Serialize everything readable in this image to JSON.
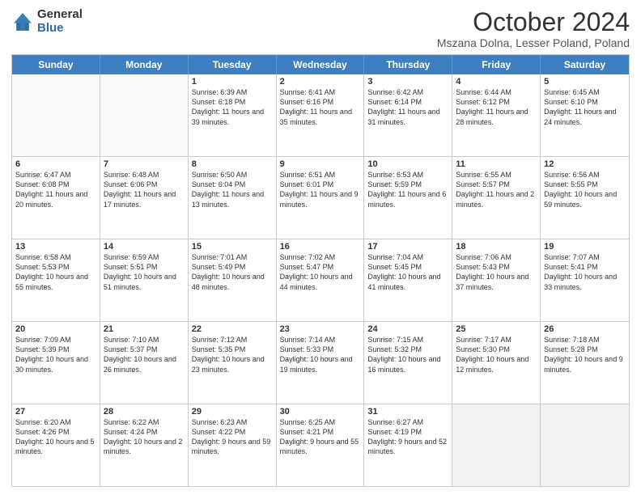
{
  "logo": {
    "general": "General",
    "blue": "Blue"
  },
  "header": {
    "month": "October 2024",
    "location": "Mszana Dolna, Lesser Poland, Poland"
  },
  "days": [
    "Sunday",
    "Monday",
    "Tuesday",
    "Wednesday",
    "Thursday",
    "Friday",
    "Saturday"
  ],
  "weeks": [
    [
      {
        "day": "",
        "content": ""
      },
      {
        "day": "",
        "content": ""
      },
      {
        "day": "1",
        "content": "Sunrise: 6:39 AM\nSunset: 6:18 PM\nDaylight: 11 hours and 39 minutes."
      },
      {
        "day": "2",
        "content": "Sunrise: 6:41 AM\nSunset: 6:16 PM\nDaylight: 11 hours and 35 minutes."
      },
      {
        "day": "3",
        "content": "Sunrise: 6:42 AM\nSunset: 6:14 PM\nDaylight: 11 hours and 31 minutes."
      },
      {
        "day": "4",
        "content": "Sunrise: 6:44 AM\nSunset: 6:12 PM\nDaylight: 11 hours and 28 minutes."
      },
      {
        "day": "5",
        "content": "Sunrise: 6:45 AM\nSunset: 6:10 PM\nDaylight: 11 hours and 24 minutes."
      }
    ],
    [
      {
        "day": "6",
        "content": "Sunrise: 6:47 AM\nSunset: 6:08 PM\nDaylight: 11 hours and 20 minutes."
      },
      {
        "day": "7",
        "content": "Sunrise: 6:48 AM\nSunset: 6:06 PM\nDaylight: 11 hours and 17 minutes."
      },
      {
        "day": "8",
        "content": "Sunrise: 6:50 AM\nSunset: 6:04 PM\nDaylight: 11 hours and 13 minutes."
      },
      {
        "day": "9",
        "content": "Sunrise: 6:51 AM\nSunset: 6:01 PM\nDaylight: 11 hours and 9 minutes."
      },
      {
        "day": "10",
        "content": "Sunrise: 6:53 AM\nSunset: 5:59 PM\nDaylight: 11 hours and 6 minutes."
      },
      {
        "day": "11",
        "content": "Sunrise: 6:55 AM\nSunset: 5:57 PM\nDaylight: 11 hours and 2 minutes."
      },
      {
        "day": "12",
        "content": "Sunrise: 6:56 AM\nSunset: 5:55 PM\nDaylight: 10 hours and 59 minutes."
      }
    ],
    [
      {
        "day": "13",
        "content": "Sunrise: 6:58 AM\nSunset: 5:53 PM\nDaylight: 10 hours and 55 minutes."
      },
      {
        "day": "14",
        "content": "Sunrise: 6:59 AM\nSunset: 5:51 PM\nDaylight: 10 hours and 51 minutes."
      },
      {
        "day": "15",
        "content": "Sunrise: 7:01 AM\nSunset: 5:49 PM\nDaylight: 10 hours and 48 minutes."
      },
      {
        "day": "16",
        "content": "Sunrise: 7:02 AM\nSunset: 5:47 PM\nDaylight: 10 hours and 44 minutes."
      },
      {
        "day": "17",
        "content": "Sunrise: 7:04 AM\nSunset: 5:45 PM\nDaylight: 10 hours and 41 minutes."
      },
      {
        "day": "18",
        "content": "Sunrise: 7:06 AM\nSunset: 5:43 PM\nDaylight: 10 hours and 37 minutes."
      },
      {
        "day": "19",
        "content": "Sunrise: 7:07 AM\nSunset: 5:41 PM\nDaylight: 10 hours and 33 minutes."
      }
    ],
    [
      {
        "day": "20",
        "content": "Sunrise: 7:09 AM\nSunset: 5:39 PM\nDaylight: 10 hours and 30 minutes."
      },
      {
        "day": "21",
        "content": "Sunrise: 7:10 AM\nSunset: 5:37 PM\nDaylight: 10 hours and 26 minutes."
      },
      {
        "day": "22",
        "content": "Sunrise: 7:12 AM\nSunset: 5:35 PM\nDaylight: 10 hours and 23 minutes."
      },
      {
        "day": "23",
        "content": "Sunrise: 7:14 AM\nSunset: 5:33 PM\nDaylight: 10 hours and 19 minutes."
      },
      {
        "day": "24",
        "content": "Sunrise: 7:15 AM\nSunset: 5:32 PM\nDaylight: 10 hours and 16 minutes."
      },
      {
        "day": "25",
        "content": "Sunrise: 7:17 AM\nSunset: 5:30 PM\nDaylight: 10 hours and 12 minutes."
      },
      {
        "day": "26",
        "content": "Sunrise: 7:18 AM\nSunset: 5:28 PM\nDaylight: 10 hours and 9 minutes."
      }
    ],
    [
      {
        "day": "27",
        "content": "Sunrise: 6:20 AM\nSunset: 4:26 PM\nDaylight: 10 hours and 5 minutes."
      },
      {
        "day": "28",
        "content": "Sunrise: 6:22 AM\nSunset: 4:24 PM\nDaylight: 10 hours and 2 minutes."
      },
      {
        "day": "29",
        "content": "Sunrise: 6:23 AM\nSunset: 4:22 PM\nDaylight: 9 hours and 59 minutes."
      },
      {
        "day": "30",
        "content": "Sunrise: 6:25 AM\nSunset: 4:21 PM\nDaylight: 9 hours and 55 minutes."
      },
      {
        "day": "31",
        "content": "Sunrise: 6:27 AM\nSunset: 4:19 PM\nDaylight: 9 hours and 52 minutes."
      },
      {
        "day": "",
        "content": ""
      },
      {
        "day": "",
        "content": ""
      }
    ]
  ]
}
